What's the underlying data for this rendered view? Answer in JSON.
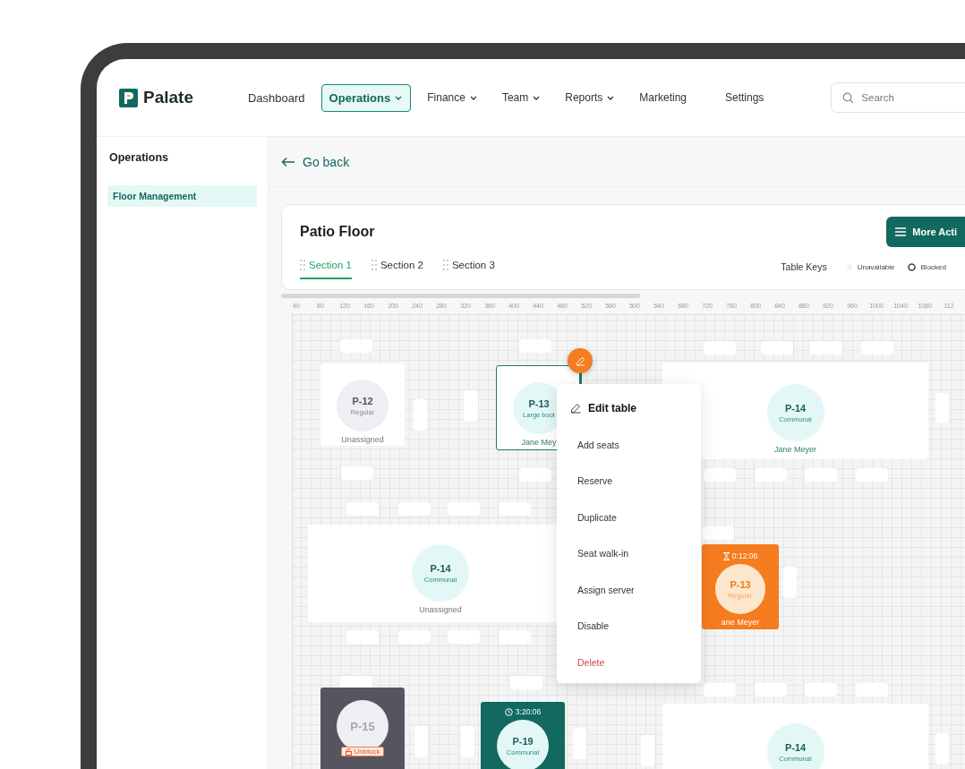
{
  "header": {
    "logo": "Palate",
    "nav": [
      {
        "label": "Dashboard",
        "selected": false,
        "dropdown": false
      },
      {
        "label": "Operations",
        "selected": true,
        "dropdown": true
      },
      {
        "label": "Finance",
        "selected": false,
        "dropdown": true
      },
      {
        "label": "Team",
        "selected": false,
        "dropdown": true
      },
      {
        "label": "Reports",
        "selected": false,
        "dropdown": true
      },
      {
        "label": "Marketing",
        "selected": false,
        "dropdown": false
      },
      {
        "label": "Settings",
        "selected": false,
        "dropdown": false
      }
    ],
    "search": {
      "placeholder": "Search"
    }
  },
  "sidebar": {
    "title": "Operations",
    "items": [
      {
        "label": "Floor Management",
        "selected": true
      }
    ]
  },
  "back_link": "Go back",
  "floor": {
    "title": "Patio Floor",
    "action_button": "More Acti",
    "tabs": [
      {
        "label": "Section 1",
        "selected": true
      },
      {
        "label": "Section 2",
        "selected": false
      },
      {
        "label": "Section 3",
        "selected": false
      }
    ],
    "table_keys": {
      "label": "Table Keys",
      "items": [
        {
          "kind": "unavailable",
          "label": "Unavailable"
        },
        {
          "kind": "blocked",
          "label": "Blocked"
        }
      ]
    }
  },
  "ruler": {
    "labels": [
      "40",
      "80",
      "120",
      "160",
      "200",
      "240",
      "280",
      "320",
      "360",
      "400",
      "440",
      "480",
      "520",
      "560",
      "600",
      "640",
      "680",
      "720",
      "760",
      "800",
      "840",
      "880",
      "920",
      "960",
      "1000",
      "1040",
      "1080",
      "112"
    ]
  },
  "tables": [
    {
      "kind": "idle",
      "name": "P-12",
      "type": "Regular",
      "server": "Unassigned",
      "assigned": false,
      "selected": false
    },
    {
      "kind": "available",
      "name": "P-13",
      "type": "Large boot",
      "server": "Jane Mey",
      "assigned": true,
      "selected": true
    },
    {
      "kind": "available",
      "name": "P-14",
      "type": "Communal",
      "server": "Jane Meyer",
      "assigned": true,
      "selected": false
    },
    {
      "kind": "available",
      "name": "P-14",
      "type": "Communal",
      "server": "Unassigned",
      "assigned": false,
      "selected": false
    },
    {
      "kind": "late",
      "name": "P-13",
      "type": "Regular",
      "server": "ane Meyer",
      "assigned": true,
      "timer": "0:12:06",
      "selected": false
    },
    {
      "kind": "blocked",
      "name": "P-15",
      "action": "Unblock",
      "selected": false
    },
    {
      "kind": "seated",
      "name": "P-19",
      "type": "Communal",
      "timer": "3:20:06",
      "selected": false
    },
    {
      "kind": "available",
      "name": "P-14",
      "type": "Communal",
      "selected": false
    }
  ],
  "context_menu": {
    "items": [
      {
        "kind": "header",
        "label": "Edit table"
      },
      {
        "kind": "item",
        "label": "Add seats"
      },
      {
        "kind": "item",
        "label": "Reserve"
      },
      {
        "kind": "item",
        "label": "Duplicate"
      },
      {
        "kind": "item",
        "label": "Seat walk-in"
      },
      {
        "kind": "item",
        "label": "Assign server"
      },
      {
        "kind": "item",
        "label": "Disable"
      },
      {
        "kind": "danger",
        "label": "Delete"
      }
    ]
  }
}
